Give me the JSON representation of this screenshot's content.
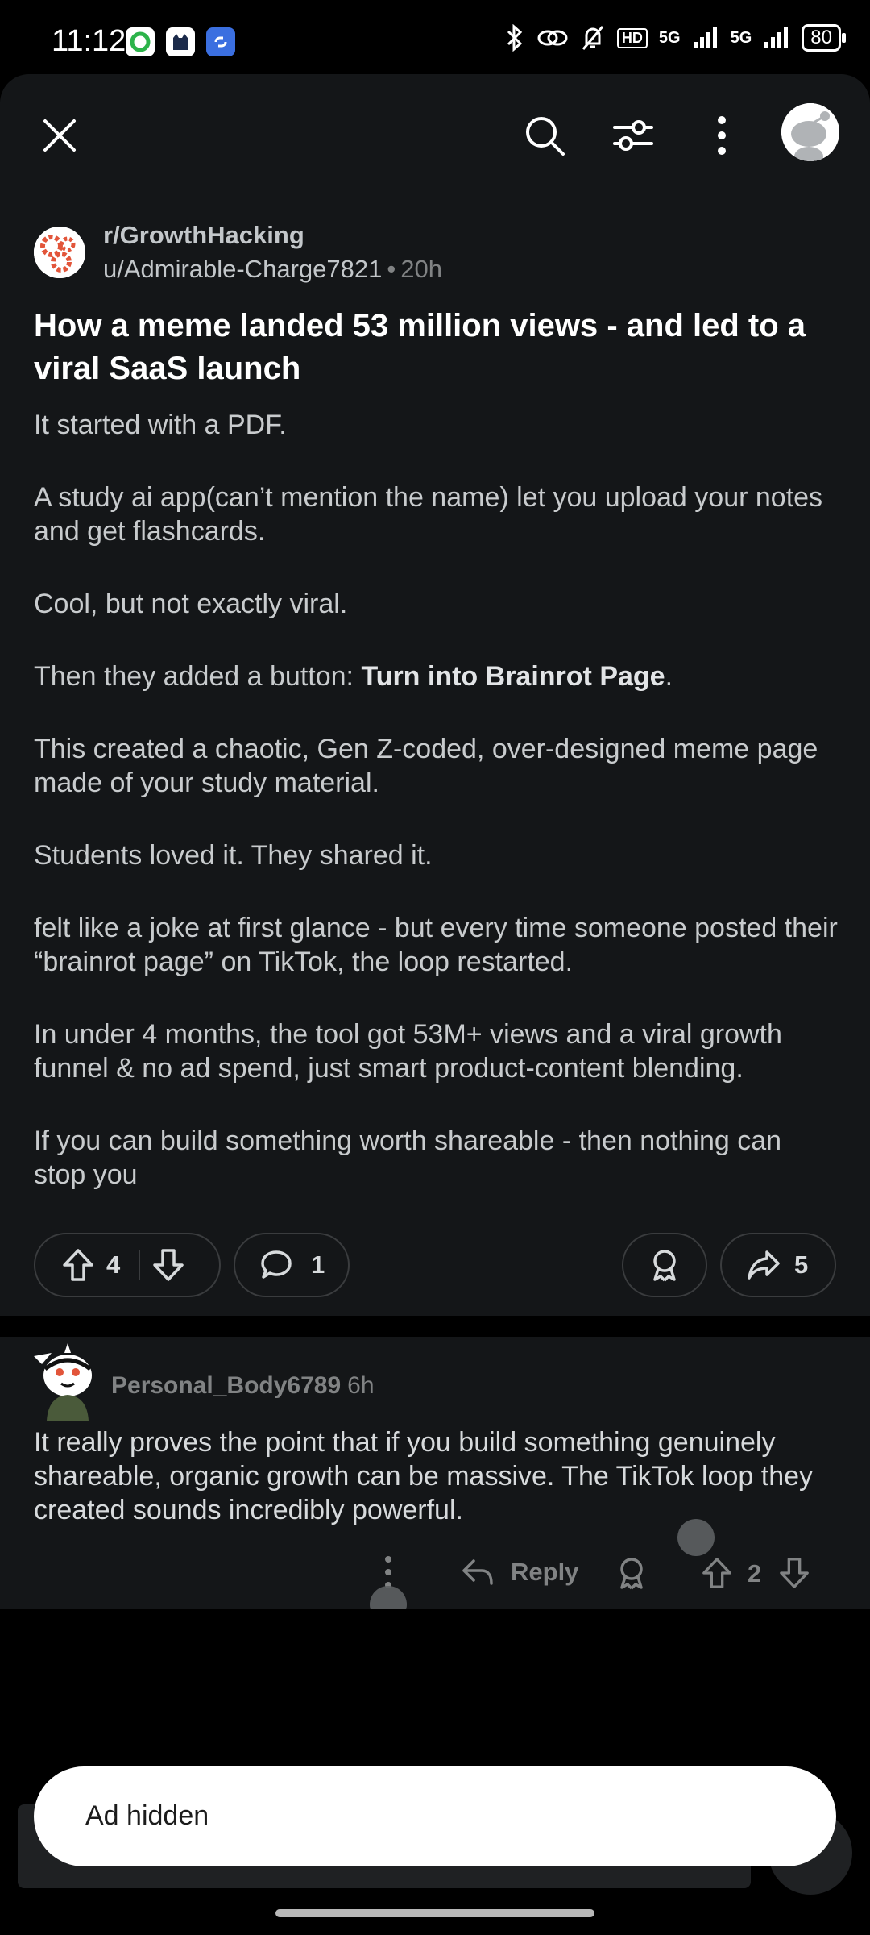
{
  "status_bar": {
    "time": "11:12",
    "network_1": "5G",
    "network_2": "5G",
    "battery": "80",
    "hd": "HD"
  },
  "post": {
    "subreddit": "r/GrowthHacking",
    "author": "u/Admirable-Charge7821",
    "age": "20h",
    "title": "How a meme landed 53 million views - and led to a viral SaaS launch",
    "paragraphs": {
      "p1": "It started with a PDF.",
      "p2": "A study ai app(can’t mention the name) let you upload your notes and get flashcards.",
      "p3": "Cool, but not exactly viral.",
      "p4_prefix": "Then they added a button: ",
      "p4_bold": "Turn into Brainrot Page",
      "p4_suffix": ".",
      "p5": "This created a chaotic, Gen Z-coded, over-designed meme page made of your study material.",
      "p6": "Students loved it. They shared it.",
      "p7": "felt like a joke at first glance - but every time someone posted their “brainrot page” on TikTok, the loop restarted.",
      "p8": "In under 4 months, the tool got 53M+ views and a viral growth funnel & no ad spend, just smart product-content blending.",
      "p9": "If you can build something worth shareable - then nothing can stop you"
    },
    "actions": {
      "votes": "4",
      "comments": "1",
      "shares": "5"
    }
  },
  "comment": {
    "author": "Personal_Body6789",
    "age": "6h",
    "body": "It really proves the point that if you build something genuinely shareable, organic growth can be massive. The TikTok loop they created sounds incredibly powerful.",
    "reply_label": "Reply",
    "votes": "2"
  },
  "toast": {
    "text": "Ad hidden"
  },
  "colors": {
    "background": "#000000",
    "sheet": "#141618",
    "text": "#d7dadc",
    "muted": "#818384",
    "toast_bg": "#ffffff"
  }
}
